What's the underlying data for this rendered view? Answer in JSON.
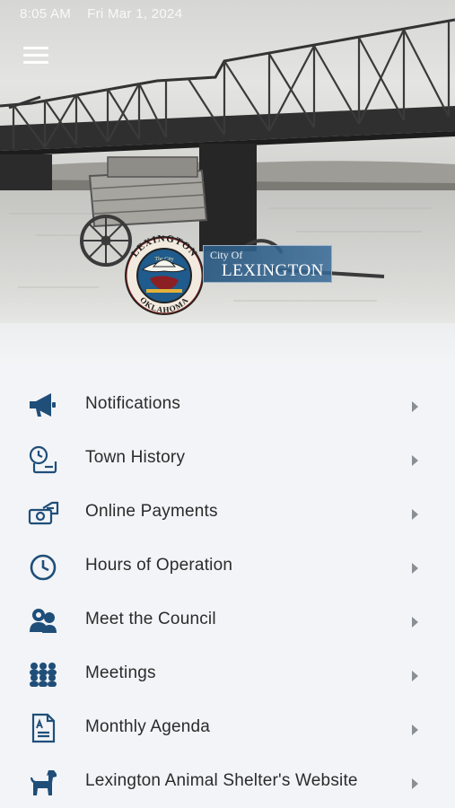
{
  "status_bar": {
    "time": "8:05 AM",
    "date": "Fri Mar 1, 2024"
  },
  "header": {
    "menu_icon": "hamburger-menu-icon",
    "logo": {
      "top_text": "LEXINGTON",
      "bottom_text": "OKLAHOMA",
      "center_text": "The City"
    },
    "banner": {
      "line1": "City Of",
      "line2": "LEXINGTON"
    }
  },
  "theme": {
    "icon_color": "#1f4e79",
    "text_color": "#2b2b2b",
    "chevron_color": "#8a8f96",
    "background": "#f2f4f7"
  },
  "menu": {
    "items": [
      {
        "label": "Notifications",
        "icon": "megaphone-icon"
      },
      {
        "label": "Town History",
        "icon": "history-scroll-icon"
      },
      {
        "label": "Online Payments",
        "icon": "payment-card-icon"
      },
      {
        "label": "Hours of Operation",
        "icon": "clock-icon"
      },
      {
        "label": "Meet the Council",
        "icon": "people-icon"
      },
      {
        "label": "Meetings",
        "icon": "meeting-group-icon"
      },
      {
        "label": "Monthly Agenda",
        "icon": "document-icon"
      },
      {
        "label": "Lexington Animal Shelter's Website",
        "icon": "dog-icon"
      }
    ]
  }
}
